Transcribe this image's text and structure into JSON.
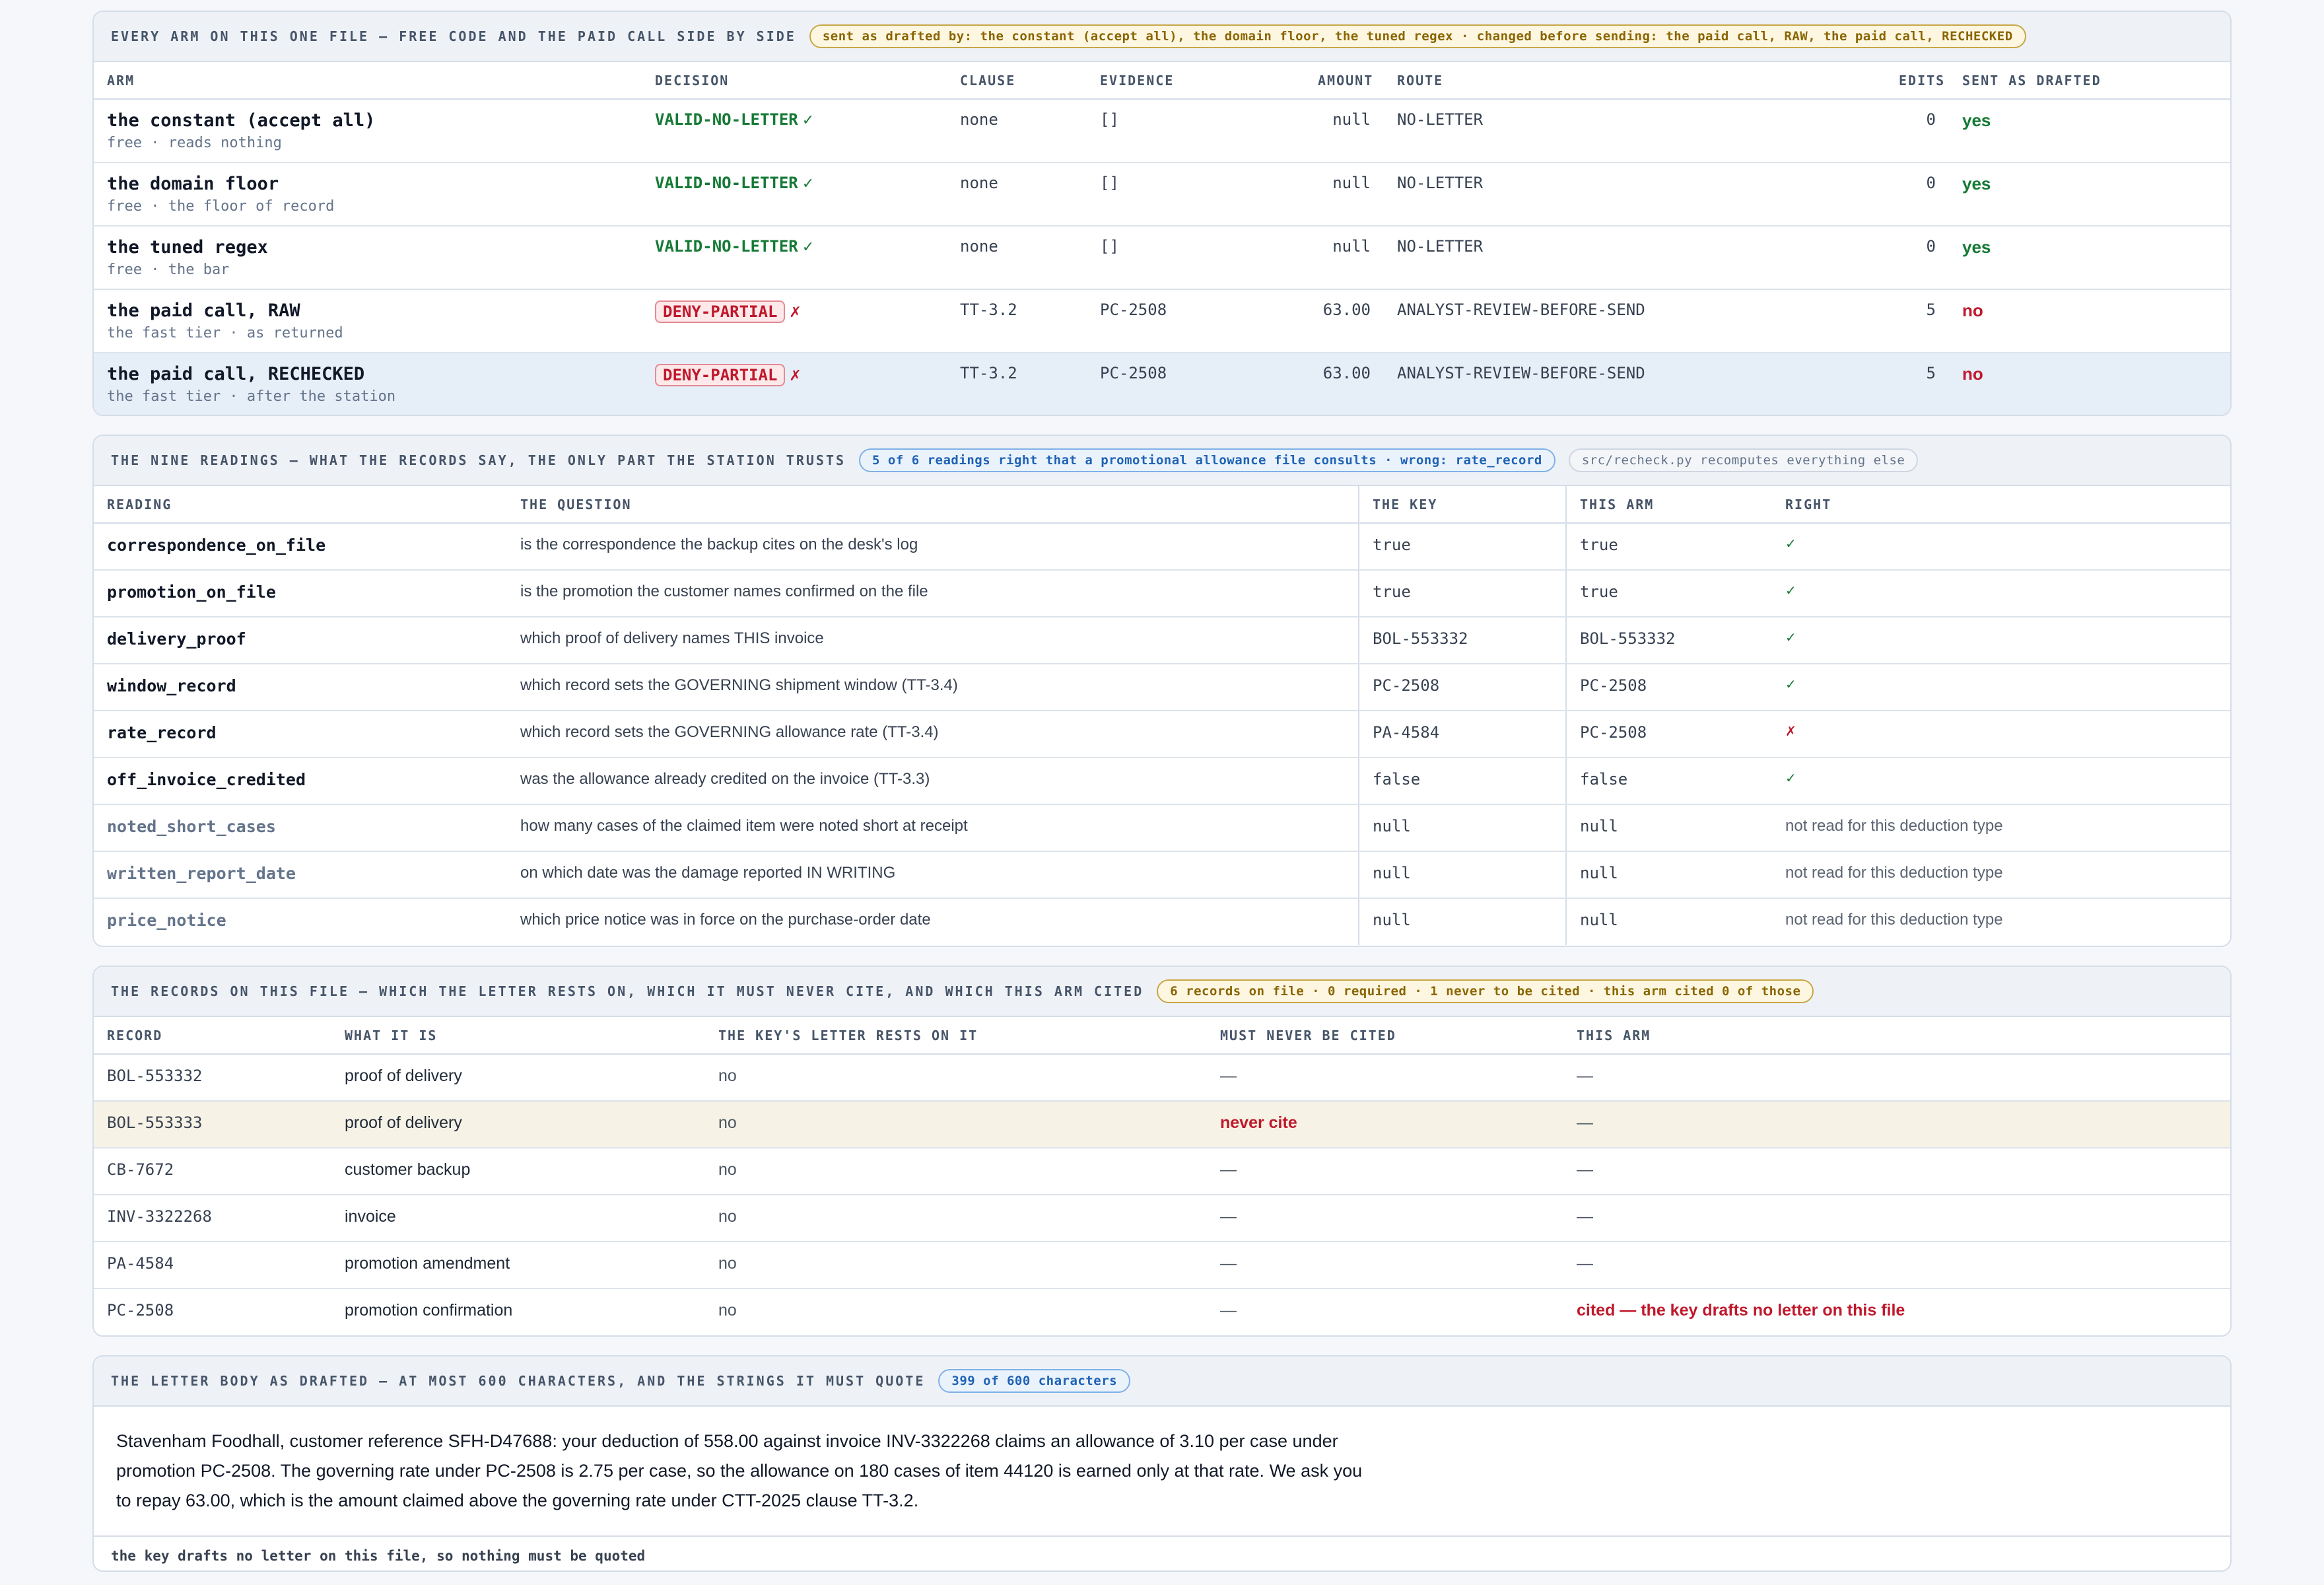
{
  "arms_panel": {
    "title": "EVERY ARM ON THIS ONE FILE — FREE CODE AND THE PAID CALL SIDE BY SIDE",
    "badge": "sent as drafted by: the constant (accept all), the domain floor, the tuned regex · changed before sending: the paid call, RAW, the paid call, RECHECKED",
    "columns": [
      "ARM",
      "DECISION",
      "CLAUSE",
      "EVIDENCE",
      "AMOUNT",
      "ROUTE",
      "EDITS",
      "SENT AS DRAFTED"
    ],
    "rows": [
      {
        "name": "the constant (accept all)",
        "sub": "free · reads nothing",
        "decision": "VALID-NO-LETTER",
        "mark": "✓",
        "clause": "none",
        "evidence": "[]",
        "amount": "null",
        "route": "NO-LETTER",
        "edits": "0",
        "sent": "yes"
      },
      {
        "name": "the domain floor",
        "sub": "free · the floor of record",
        "decision": "VALID-NO-LETTER",
        "mark": "✓",
        "clause": "none",
        "evidence": "[]",
        "amount": "null",
        "route": "NO-LETTER",
        "edits": "0",
        "sent": "yes"
      },
      {
        "name": "the tuned regex",
        "sub": "free · the bar",
        "decision": "VALID-NO-LETTER",
        "mark": "✓",
        "clause": "none",
        "evidence": "[]",
        "amount": "null",
        "route": "NO-LETTER",
        "edits": "0",
        "sent": "yes"
      },
      {
        "name": "the paid call, RAW",
        "sub": "the fast tier · as returned",
        "decision": "DENY-PARTIAL",
        "mark": "✗",
        "clause": "TT-3.2",
        "evidence": "PC-2508",
        "amount": "63.00",
        "route": "ANALYST-REVIEW-BEFORE-SEND",
        "edits": "5",
        "sent": "no"
      },
      {
        "name": "the paid call, RECHECKED",
        "sub": "the fast tier · after the station",
        "decision": "DENY-PARTIAL",
        "mark": "✗",
        "clause": "TT-3.2",
        "evidence": "PC-2508",
        "amount": "63.00",
        "route": "ANALYST-REVIEW-BEFORE-SEND",
        "edits": "5",
        "sent": "no"
      }
    ]
  },
  "readings_panel": {
    "title": "THE NINE READINGS — WHAT THE RECORDS SAY, THE ONLY PART THE STATION TRUSTS",
    "badge": "5 of 6 readings right that a promotional allowance file consults · wrong: rate_record",
    "badge2": "src/recheck.py recomputes everything else",
    "columns": [
      "READING",
      "THE QUESTION",
      "THE KEY",
      "THIS ARM",
      "RIGHT"
    ],
    "rows": [
      {
        "name": "correspondence_on_file",
        "question": "is the correspondence the backup cites on the desk's log",
        "key": "true",
        "arm": "true",
        "right": "✓",
        "status": "ok"
      },
      {
        "name": "promotion_on_file",
        "question": "is the promotion the customer names confirmed on the file",
        "key": "true",
        "arm": "true",
        "right": "✓",
        "status": "ok"
      },
      {
        "name": "delivery_proof",
        "question": "which proof of delivery names THIS invoice",
        "key": "BOL-553332",
        "arm": "BOL-553332",
        "right": "✓",
        "status": "ok"
      },
      {
        "name": "window_record",
        "question": "which record sets the GOVERNING shipment window (TT-3.4)",
        "key": "PC-2508",
        "arm": "PC-2508",
        "right": "✓",
        "status": "ok"
      },
      {
        "name": "rate_record",
        "question": "which record sets the GOVERNING allowance rate (TT-3.4)",
        "key": "PA-4584",
        "arm": "PC-2508",
        "right": "✗",
        "status": "bad"
      },
      {
        "name": "off_invoice_credited",
        "question": "was the allowance already credited on the invoice (TT-3.3)",
        "key": "false",
        "arm": "false",
        "right": "✓",
        "status": "ok"
      },
      {
        "name": "noted_short_cases",
        "question": "how many cases of the claimed item were noted short at receipt",
        "key": "null",
        "arm": "null",
        "right": "not read for this deduction type",
        "status": "na"
      },
      {
        "name": "written_report_date",
        "question": "on which date was the damage reported IN WRITING",
        "key": "null",
        "arm": "null",
        "right": "not read for this deduction type",
        "status": "na"
      },
      {
        "name": "price_notice",
        "question": "which price notice was in force on the purchase-order date",
        "key": "null",
        "arm": "null",
        "right": "not read for this deduction type",
        "status": "na"
      }
    ]
  },
  "records_panel": {
    "title": "THE RECORDS ON THIS FILE — WHICH THE LETTER RESTS ON, WHICH IT MUST NEVER CITE, AND WHICH THIS ARM CITED",
    "badge": "6 records on file · 0 required · 1 never to be cited · this arm cited 0 of those",
    "columns": [
      "RECORD",
      "WHAT IT IS",
      "THE KEY'S LETTER RESTS ON IT",
      "MUST NEVER BE CITED",
      "THIS ARM"
    ],
    "rows": [
      {
        "id": "BOL-553332",
        "what": "proof of delivery",
        "rests": "no",
        "never": "—",
        "arm": "—",
        "flag": ""
      },
      {
        "id": "BOL-553333",
        "what": "proof of delivery",
        "rests": "no",
        "never": "never cite",
        "arm": "—",
        "flag": "never"
      },
      {
        "id": "CB-7672",
        "what": "customer backup",
        "rests": "no",
        "never": "—",
        "arm": "—",
        "flag": ""
      },
      {
        "id": "INV-3322268",
        "what": "invoice",
        "rests": "no",
        "never": "—",
        "arm": "—",
        "flag": ""
      },
      {
        "id": "PA-4584",
        "what": "promotion amendment",
        "rests": "no",
        "never": "—",
        "arm": "—",
        "flag": ""
      },
      {
        "id": "PC-2508",
        "what": "promotion confirmation",
        "rests": "no",
        "never": "—",
        "arm": "cited — the key drafts no letter on this file",
        "flag": "cited"
      }
    ]
  },
  "letter_panel": {
    "title": "THE LETTER BODY AS DRAFTED — AT MOST 600 CHARACTERS, AND THE STRINGS IT MUST QUOTE",
    "badge": "399 of 600 characters",
    "body": "Stavenham Foodhall, customer reference SFH-D47688: your deduction of 558.00 against invoice INV-3322268 claims an allowance of 3.10 per case under promotion PC-2508. The governing rate under PC-2508 is 2.75 per case, so the allowance on 180 cases of item 44120 is earned only at that rate. We ask you to repay 63.00, which is the amount claimed above the governing rate under CTT-2025 clause TT-3.2.",
    "footer": "the key drafts no letter on this file, so nothing must be quoted"
  }
}
